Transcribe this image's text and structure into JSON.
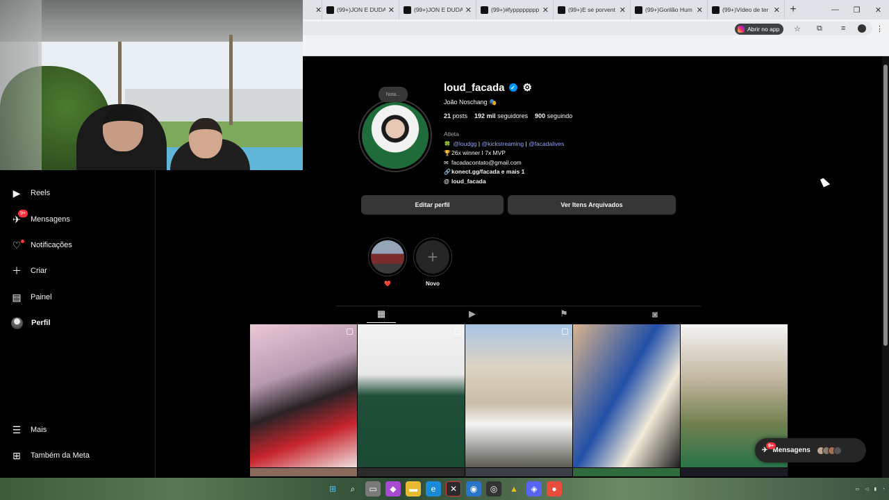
{
  "browser": {
    "tabs": [
      {
        "title": "(99+)JON E DUDA"
      },
      {
        "title": "(99+)JON E DUDA"
      },
      {
        "title": "(99+)#fypppppppp"
      },
      {
        "title": "(99+)E se porvent"
      },
      {
        "title": "(99+)Gorilão Hum"
      },
      {
        "title": "(99+)Vídeo de ter"
      }
    ],
    "open_app_label": "Abrir no app"
  },
  "sidebar": {
    "items": [
      {
        "label": "Reels",
        "icon": "reels-icon"
      },
      {
        "label": "Mensagens",
        "icon": "messenger-icon",
        "badge": "9+"
      },
      {
        "label": "Notificações",
        "icon": "heart-icon"
      },
      {
        "label": "Criar",
        "icon": "plus-icon"
      },
      {
        "label": "Painel",
        "icon": "chart-icon"
      },
      {
        "label": "Perfil",
        "icon": "avatar"
      }
    ],
    "bottom": [
      {
        "label": "Mais",
        "icon": "menu-icon"
      },
      {
        "label": "Também da Meta",
        "icon": "meta-icon"
      }
    ]
  },
  "profile": {
    "note": "Nota...",
    "username": "loud_facada",
    "full_name": "João Noschang",
    "posts_count": "21",
    "posts_label": "posts",
    "followers_count": "192 mil",
    "followers_label": "seguidores",
    "following_count": "900",
    "following_label": "seguindo",
    "category": "Atleta",
    "bio_links": [
      "@loudgg",
      "@kickstreaming",
      "@facadalives"
    ],
    "bio_separator": "|",
    "bio_line2": "26x winner I 7x MVP",
    "email": "facadacontato@gmail.com",
    "website": "konect.gg/facada e mais 1",
    "threads": "loud_facada",
    "edit_button": "Editar perfil",
    "archive_button": "Ver Itens Arquivados",
    "highlights": [
      {
        "label": "❤️"
      },
      {
        "label": "Novo"
      }
    ]
  },
  "messages_pill": {
    "label": "Mensagens",
    "badge": "9+"
  },
  "colors": {
    "accent_blue": "#0095f6",
    "badge_red": "#ff3040",
    "link": "#93a6f8"
  }
}
